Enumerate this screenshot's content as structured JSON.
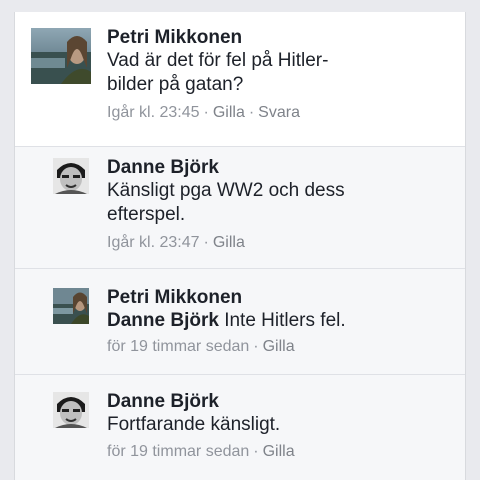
{
  "comments": [
    {
      "author": "Petri Mikkonen",
      "text": "Vad är det för fel på Hitler-bilder på gatan?",
      "text_line1": "Vad är det för fel på Hitler-",
      "text_line2": "bilder på gatan?",
      "time": "Igår kl. 23:45",
      "like": "Gilla",
      "reply": "Svara",
      "avatar_icon": "landscape-portrait-photo"
    },
    {
      "author": "Danne Björk",
      "text_line1": "Känsligt pga WW2 och dess",
      "text_line2": "efterspel.",
      "time": "Igår kl. 23:47",
      "like": "Gilla",
      "avatar_icon": "bw-face-photo"
    },
    {
      "author": "Petri Mikkonen",
      "mention": "Danne Björk",
      "text": " Inte Hitlers fel.",
      "time": "för 19 timmar sedan",
      "like": "Gilla",
      "avatar_icon": "landscape-portrait-photo"
    },
    {
      "author": "Danne Björk",
      "text": "Fortfarande känsligt.",
      "time": "för 19 timmar sedan",
      "like": "Gilla",
      "avatar_icon": "bw-face-photo"
    }
  ],
  "colors": {
    "page_bg": "#e9eaee",
    "card_bg": "#ffffff",
    "reply_bg": "#f6f7f9",
    "name": "#1d2129",
    "meta": "#90949c"
  }
}
